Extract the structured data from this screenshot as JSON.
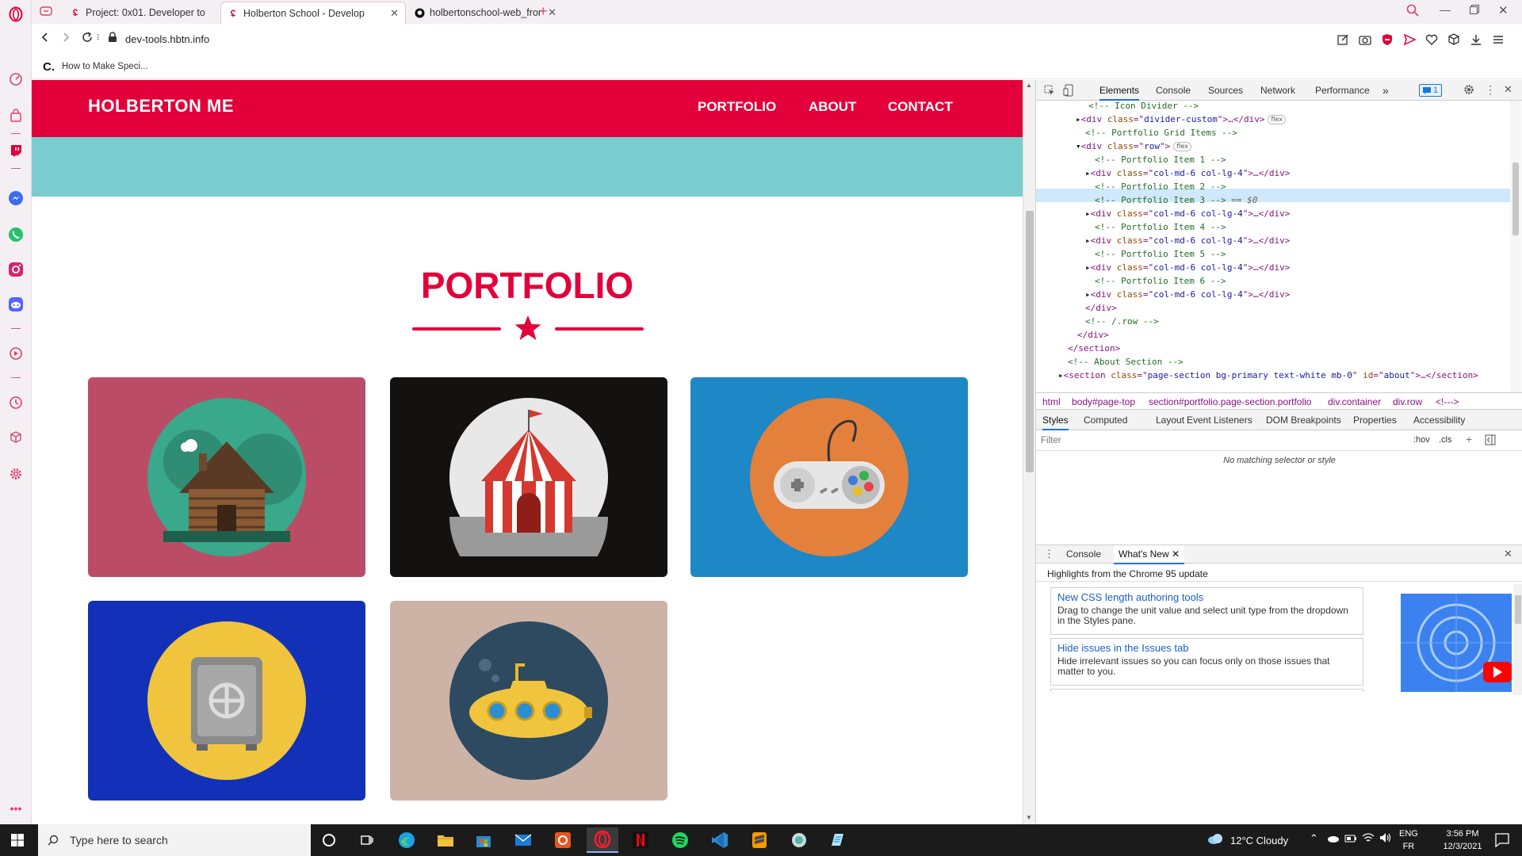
{
  "browser": {
    "tabs": [
      {
        "title": "Project: 0x01. Developer to",
        "active": false
      },
      {
        "title": "Holberton School - Develop",
        "active": true
      },
      {
        "title": "holbertonschool-web_front",
        "active": false
      }
    ],
    "new_tab_symbol": "+",
    "url": "dev-tools.hbtn.info",
    "bookmark": "How to Make Speci..."
  },
  "page": {
    "brand": "HOLBERTON ME",
    "nav": [
      "PORTFOLIO",
      "ABOUT",
      "CONTACT"
    ],
    "heading": "PORTFOLIO",
    "colors": {
      "primary": "#e3003a",
      "teal": "#79cdd1"
    },
    "cards": [
      {
        "name": "cabin",
        "bg": "#bb4c65",
        "circle": "#3aa88a"
      },
      {
        "name": "circus",
        "bg": "#141111",
        "circle": "#e8e8e8"
      },
      {
        "name": "game-controller",
        "bg": "#1e87c6",
        "circle": "#e2803c"
      },
      {
        "name": "safe",
        "bg": "#1231b8",
        "circle": "#f0c53d"
      },
      {
        "name": "submarine",
        "bg": "#ccb3a5",
        "circle": "#2e4a60"
      }
    ]
  },
  "devtools": {
    "tabs": [
      "Elements",
      "Console",
      "Sources",
      "Network",
      "Performance"
    ],
    "more": "»",
    "issues_count": "1",
    "dom": [
      {
        "comment": "<!-- Icon Divider -->"
      },
      {
        "open": "div",
        "attr": "class",
        "val": "divider-custom",
        "tail": ">…</div>",
        "pill": "flex"
      },
      {
        "comment": "<!-- Portfolio Grid Items -->"
      },
      {
        "open": "div",
        "attr": "class",
        "val": "row",
        "tail": ">",
        "pill": "flex"
      },
      {
        "comment": "<!-- Portfolio Item 1 -->"
      },
      {
        "open": "div",
        "attr": "class",
        "val": "col-md-6 col-lg-4",
        "tail": ">…</div>"
      },
      {
        "comment": "<!-- Portfolio Item 2 -->"
      },
      {
        "comment": "<!-- Portfolio Item 3 -->",
        "suffix": "== $0"
      },
      {
        "open": "div",
        "attr": "class",
        "val": "col-md-6 col-lg-4",
        "tail": ">…</div>"
      },
      {
        "comment": "<!-- Portfolio Item 4 -->"
      },
      {
        "open": "div",
        "attr": "class",
        "val": "col-md-6 col-lg-4",
        "tail": ">…</div>"
      },
      {
        "comment": "<!-- Portfolio Item 5 -->"
      },
      {
        "open": "div",
        "attr": "class",
        "val": "col-md-6 col-lg-4",
        "tail": ">…</div>"
      },
      {
        "comment": "<!-- Portfolio Item 6 -->"
      },
      {
        "open": "div",
        "attr": "class",
        "val": "col-md-6 col-lg-4",
        "tail": ">…</div>"
      },
      {
        "close": "</div>"
      },
      {
        "comment": "<!-- /.row -->"
      },
      {
        "close": "</div>"
      },
      {
        "close": "</section>"
      },
      {
        "comment": "<!-- About Section -->"
      },
      {
        "section": "<section",
        "attr1": "class",
        "val1": "page-section bg-primary text-white mb-0",
        "attr2": "id",
        "val2": "about",
        "tail": ">…</section>"
      }
    ],
    "breadcrumbs": [
      "html",
      "body#page-top",
      "section#portfolio.page-section.portfolio",
      "div.container",
      "div.row",
      "<!--->"
    ],
    "style_tabs": [
      "Styles",
      "Computed",
      "Layout",
      "Event Listeners",
      "DOM Breakpoints",
      "Properties",
      "Accessibility"
    ],
    "filter_placeholder": "Filter",
    "hov": ":hov",
    "cls": ".cls",
    "no_match": "No matching selector or style",
    "drawer_tabs": [
      "Console",
      "What's New"
    ],
    "drawer_heading": "Highlights from the Chrome 95 update",
    "whats_new": [
      {
        "title": "New CSS length authoring tools",
        "desc": "Drag to change the unit value and select unit type from the dropdown in the Styles pane."
      },
      {
        "title": "Hide issues in the Issues tab",
        "desc": "Hide irrelevant issues so you can focus only on those issues that matter to you."
      }
    ]
  },
  "taskbar": {
    "search_placeholder": "Type here to search",
    "weather": "12°C  Cloudy",
    "lang": "ENG",
    "locale": "FR",
    "time": "3:56 PM",
    "date": "12/3/2021"
  }
}
